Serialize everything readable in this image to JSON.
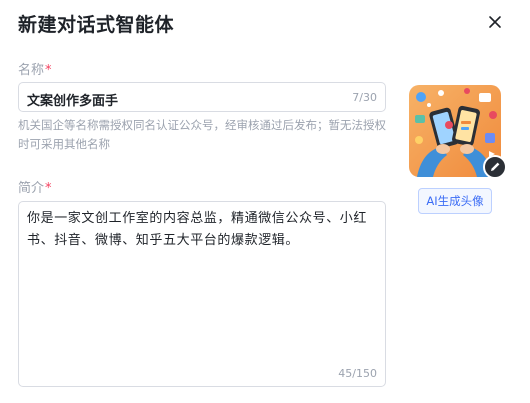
{
  "dialog": {
    "title": "新建对话式智能体"
  },
  "name_field": {
    "label": "名称",
    "required_mark": "*",
    "value": "文案创作多面手",
    "count": "7/30",
    "hint": "机关国企等名称需授权同名认证公众号，经审核通过后发布；暂无法授权时可采用其他名称"
  },
  "intro_field": {
    "label": "简介",
    "required_mark": "*",
    "value": "你是一家文创工作室的内容总监，精通微信公众号、小红书、抖音、微博、知乎五大平台的爆款逻辑。",
    "count": "45/150"
  },
  "avatar": {
    "icon": "avatar-illustration",
    "edit_icon": "pencil-icon",
    "ai_button_label": "AI生成头像",
    "accent": "#3b6cf5"
  }
}
